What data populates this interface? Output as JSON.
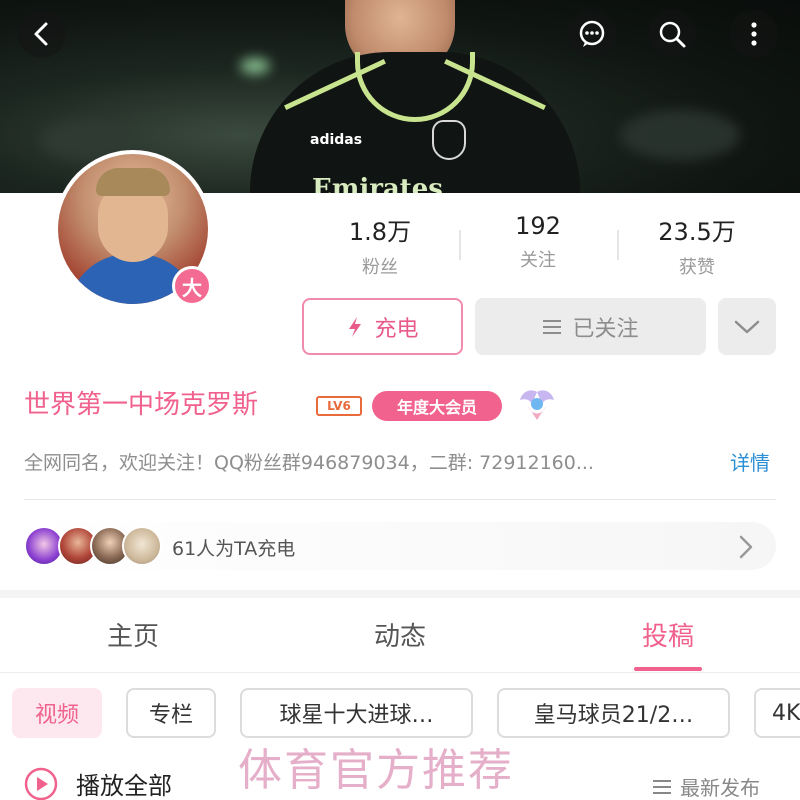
{
  "header": {
    "back_icon": "back-arrow-icon",
    "message_icon": "message-icon",
    "search_icon": "search-icon",
    "more_icon": "more-vertical-icon"
  },
  "banner": {
    "jersey_brand": "adidas",
    "jersey_sponsor": "Emirates"
  },
  "profile": {
    "avatar_badge": "大",
    "name": "世界第一中场克罗斯",
    "level": "LV6",
    "vip_label": "年度大会员",
    "bio": "全网同名，欢迎关注！QQ粉丝群946879034，二群: 72912160...",
    "bio_more": "详情"
  },
  "stats": [
    {
      "value": "1.8万",
      "label": "粉丝"
    },
    {
      "value": "192",
      "label": "关注"
    },
    {
      "value": "23.5万",
      "label": "获赞"
    }
  ],
  "actions": {
    "charge_label": "充电",
    "follow_label": "已关注"
  },
  "charge_row": {
    "text": "61人为TA充电"
  },
  "tabs": [
    {
      "label": "主页",
      "active": false
    },
    {
      "label": "动态",
      "active": false
    },
    {
      "label": "投稿",
      "active": true
    }
  ],
  "chips": [
    {
      "label": "视频",
      "active": true
    },
    {
      "label": "专栏",
      "active": false
    },
    {
      "label": "球星十大进球…",
      "active": false
    },
    {
      "label": "皇马球员21/2…",
      "active": false
    },
    {
      "label": "4K",
      "active": false
    }
  ],
  "watermark": "体育官方推荐",
  "list_header": {
    "play_all": "播放全部",
    "sort_label": "最新发布"
  },
  "colors": {
    "accent": "#f0628d",
    "link": "#2c8fd6"
  }
}
